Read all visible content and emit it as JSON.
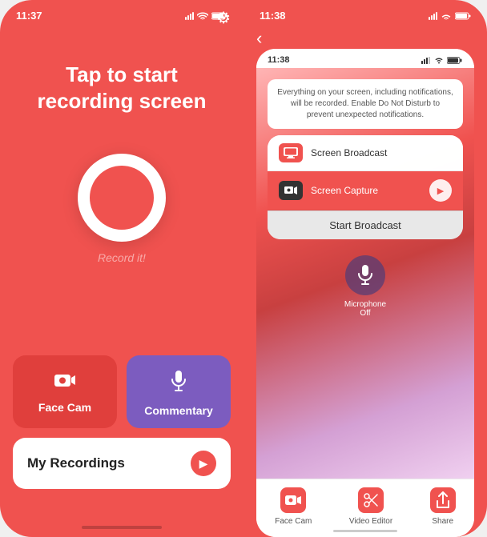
{
  "left_phone": {
    "status_bar": {
      "time": "11:37",
      "signal": "●●",
      "wifi": "WiFi",
      "battery": "Battery"
    },
    "gear_icon": "⚙",
    "title": "Tap to start recording screen",
    "record_label": "Record it!",
    "face_cam": {
      "icon": "📷",
      "label": "Face Cam"
    },
    "commentary": {
      "icon": "🎙",
      "label": "Commentary"
    },
    "my_recordings": {
      "label": "My Recordings",
      "arrow_icon": "▶"
    }
  },
  "right_phone": {
    "status_bar": {
      "time": "11:38"
    },
    "back_icon": "‹",
    "inner_status": {
      "time": "11:38"
    },
    "broadcast_warning": "Everything on your screen, including notifications, will be recorded. Enable Do Not Disturb to prevent unexpected notifications.",
    "broadcast_menu": {
      "items": [
        {
          "label": "Screen Broadcast",
          "type": "normal"
        },
        {
          "label": "Screen Capture",
          "type": "red",
          "has_play": true
        },
        {
          "label": "Start Broadcast",
          "type": "start"
        }
      ]
    },
    "microphone": {
      "label": "Microphone\nOff",
      "icon": "🎙"
    },
    "tabs": [
      {
        "label": "Face Cam",
        "icon": "📷"
      },
      {
        "label": "Video Editor",
        "icon": "✂"
      },
      {
        "label": "Share",
        "icon": "↑"
      }
    ]
  }
}
